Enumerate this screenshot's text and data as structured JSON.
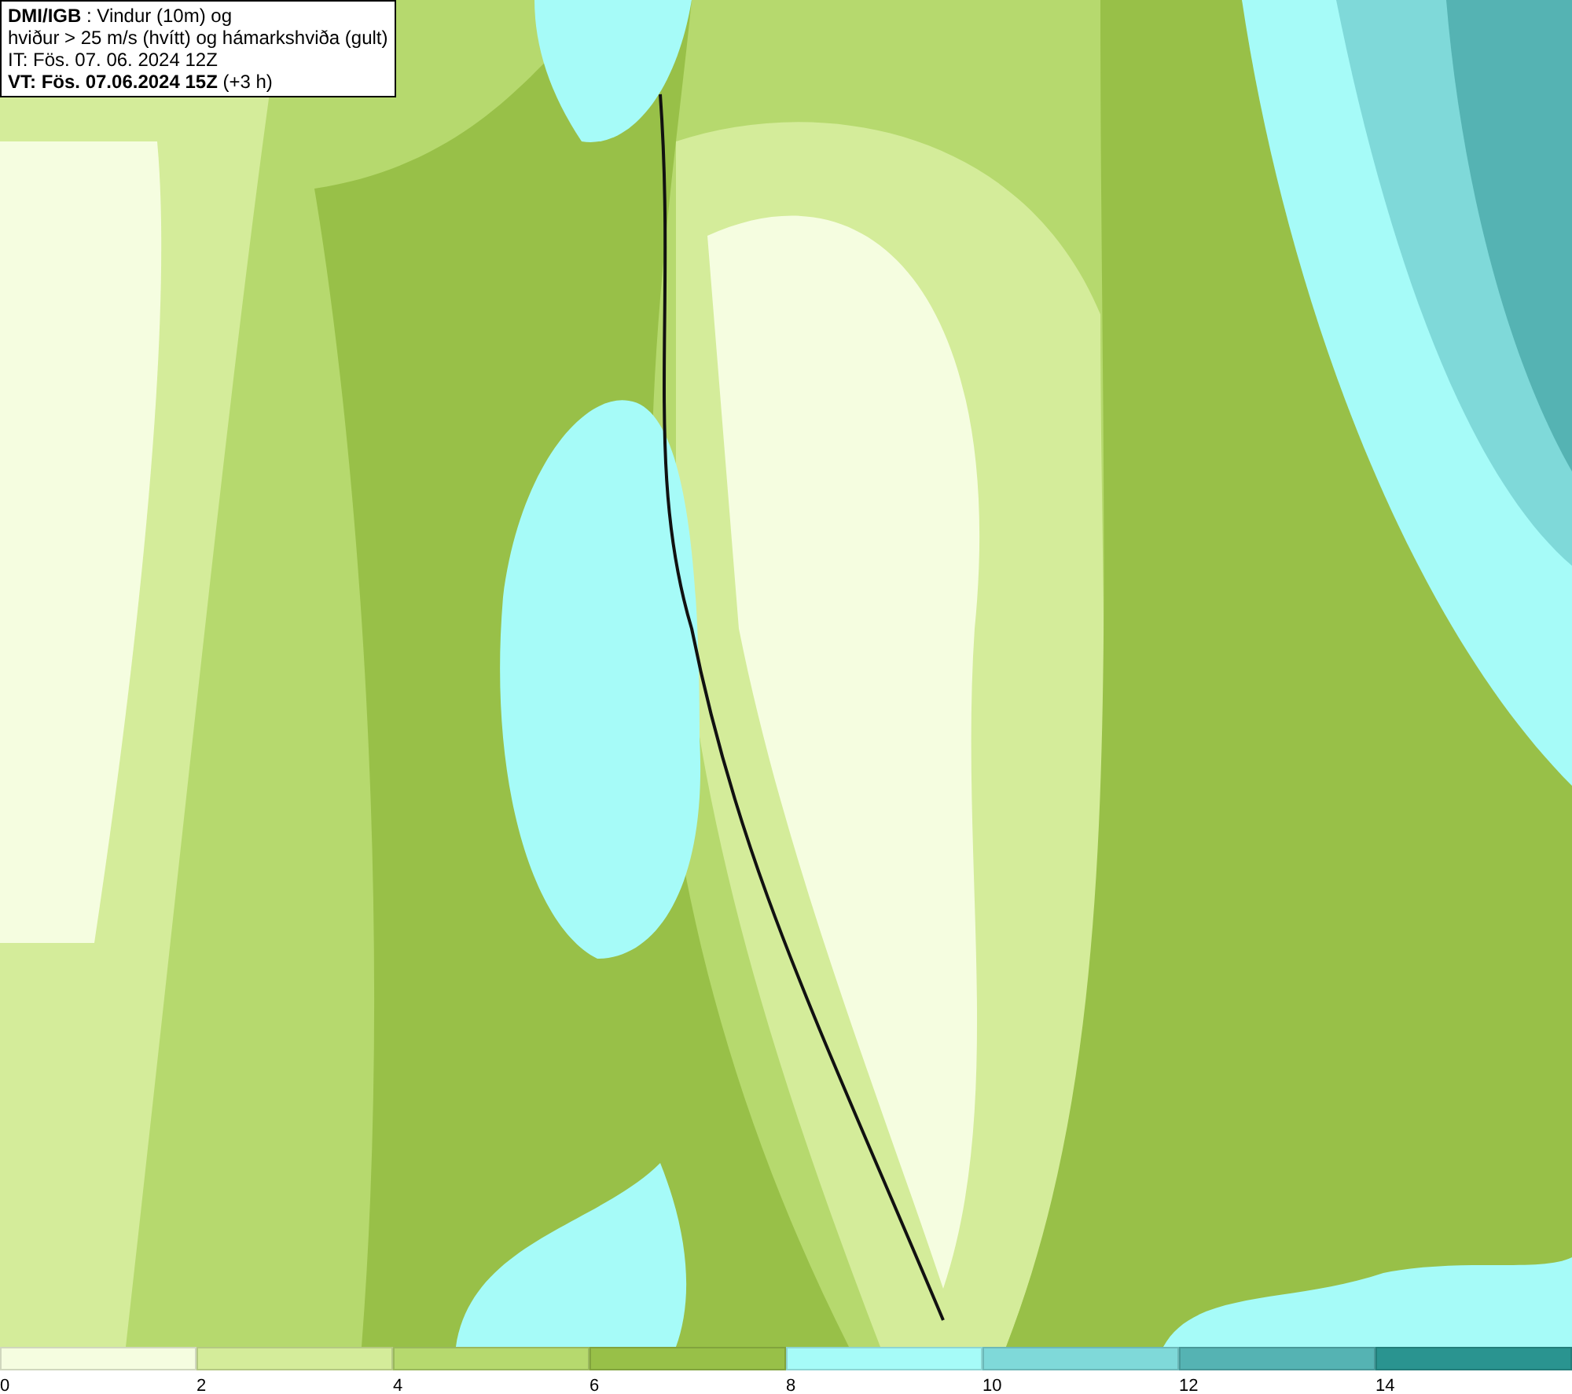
{
  "title_box": {
    "lines": [
      "**DMI/IGB** : Vindur (10m) og",
      "hviður > 25 m/s (hvítt) og hámarkshviða (gult)",
      "IT: Fös. 07. 06. 2024 12Z",
      "**VT: Fös. 07.06.2024 15Z** (+3 h)"
    ]
  },
  "legend": [
    {
      "label": "0",
      "color": "#f5fde0"
    },
    {
      "label": "2",
      "color": "#d4ec9a"
    },
    {
      "label": "4",
      "color": "#b6d96e"
    },
    {
      "label": "6",
      "color": "#98c048"
    },
    {
      "label": "8",
      "color": "#a6fbf8"
    },
    {
      "label": "10",
      "color": "#7fd9d9"
    },
    {
      "label": "12",
      "color": "#55b3b3"
    },
    {
      "label": "14",
      "color": "#2a9490"
    }
  ]
}
